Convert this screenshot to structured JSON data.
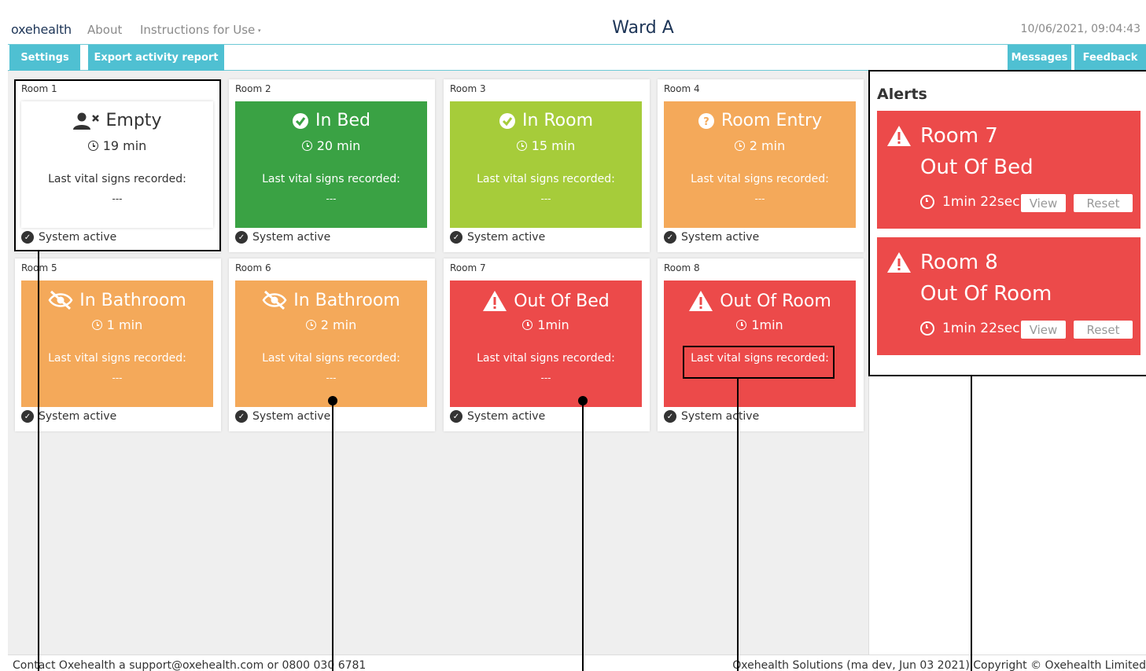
{
  "header": {
    "logo": "oxehealth",
    "nav": {
      "about": "About",
      "instructions": "Instructions for Use",
      "caret": "▾"
    },
    "title": "Ward A",
    "datetime": "10/06/2021, 09:04:43"
  },
  "toolbar": {
    "settings": "Settings",
    "export": "Export activity report",
    "messages": "Messages",
    "feedback": "Feedback"
  },
  "rooms": [
    {
      "label": "Room 1",
      "status": "Empty",
      "time": "19 min",
      "vitals_label": "Last vital signs recorded:",
      "vitals_value": "---",
      "system": "System active",
      "color": "#ffffff",
      "icon": "person-x-icon"
    },
    {
      "label": "Room 2",
      "status": "In Bed",
      "time": "20 min",
      "vitals_label": "Last vital signs recorded:",
      "vitals_value": "---",
      "system": "System active",
      "color": "#3aa244",
      "icon": "check-circle-icon"
    },
    {
      "label": "Room 3",
      "status": "In Room",
      "time": "15 min",
      "vitals_label": "Last vital signs recorded:",
      "vitals_value": "---",
      "system": "System active",
      "color": "#a6cc3a",
      "icon": "check-circle-icon"
    },
    {
      "label": "Room 4",
      "status": "Room Entry",
      "time": "2 min",
      "vitals_label": "Last vital signs recorded:",
      "vitals_value": "---",
      "system": "System active",
      "color": "#f4a95a",
      "icon": "question-circle-icon"
    },
    {
      "label": "Room 5",
      "status": "In Bathroom",
      "time": "1 min",
      "vitals_label": "Last vital signs recorded:",
      "vitals_value": "---",
      "system": "System active",
      "color": "#f4a95a",
      "icon": "eye-slash-icon"
    },
    {
      "label": "Room 6",
      "status": "In Bathroom",
      "time": "2 min",
      "vitals_label": "Last vital signs recorded:",
      "vitals_value": "---",
      "system": "System active",
      "color": "#f4a95a",
      "icon": "eye-slash-icon"
    },
    {
      "label": "Room 7",
      "status": "Out Of Bed",
      "time": "1min",
      "vitals_label": "Last vital signs recorded:",
      "vitals_value": "---",
      "system": "System active",
      "color": "#ec4a4a",
      "icon": "warning-icon"
    },
    {
      "label": "Room 8",
      "status": "Out Of Room",
      "time": "1min",
      "vitals_label": "Last vital signs recorded:",
      "vitals_value": "---",
      "system": "System active",
      "color": "#ec4a4a",
      "icon": "warning-icon"
    }
  ],
  "alerts": {
    "title": "Alerts",
    "items": [
      {
        "room": "Room 7",
        "status": "Out Of Bed",
        "time": "1min 22sec",
        "view": "View",
        "reset": "Reset"
      },
      {
        "room": "Room 8",
        "status": "Out Of Room",
        "time": "1min 22sec",
        "view": "View",
        "reset": "Reset"
      }
    ]
  },
  "footer": {
    "contact": "Contact Oxehealth a support@oxehealth.com or 0800 030 6781",
    "copyright": "Oxehealth Solutions (ma  dev, Jun 03 2021) Copyright © Oxehealth Limited"
  }
}
